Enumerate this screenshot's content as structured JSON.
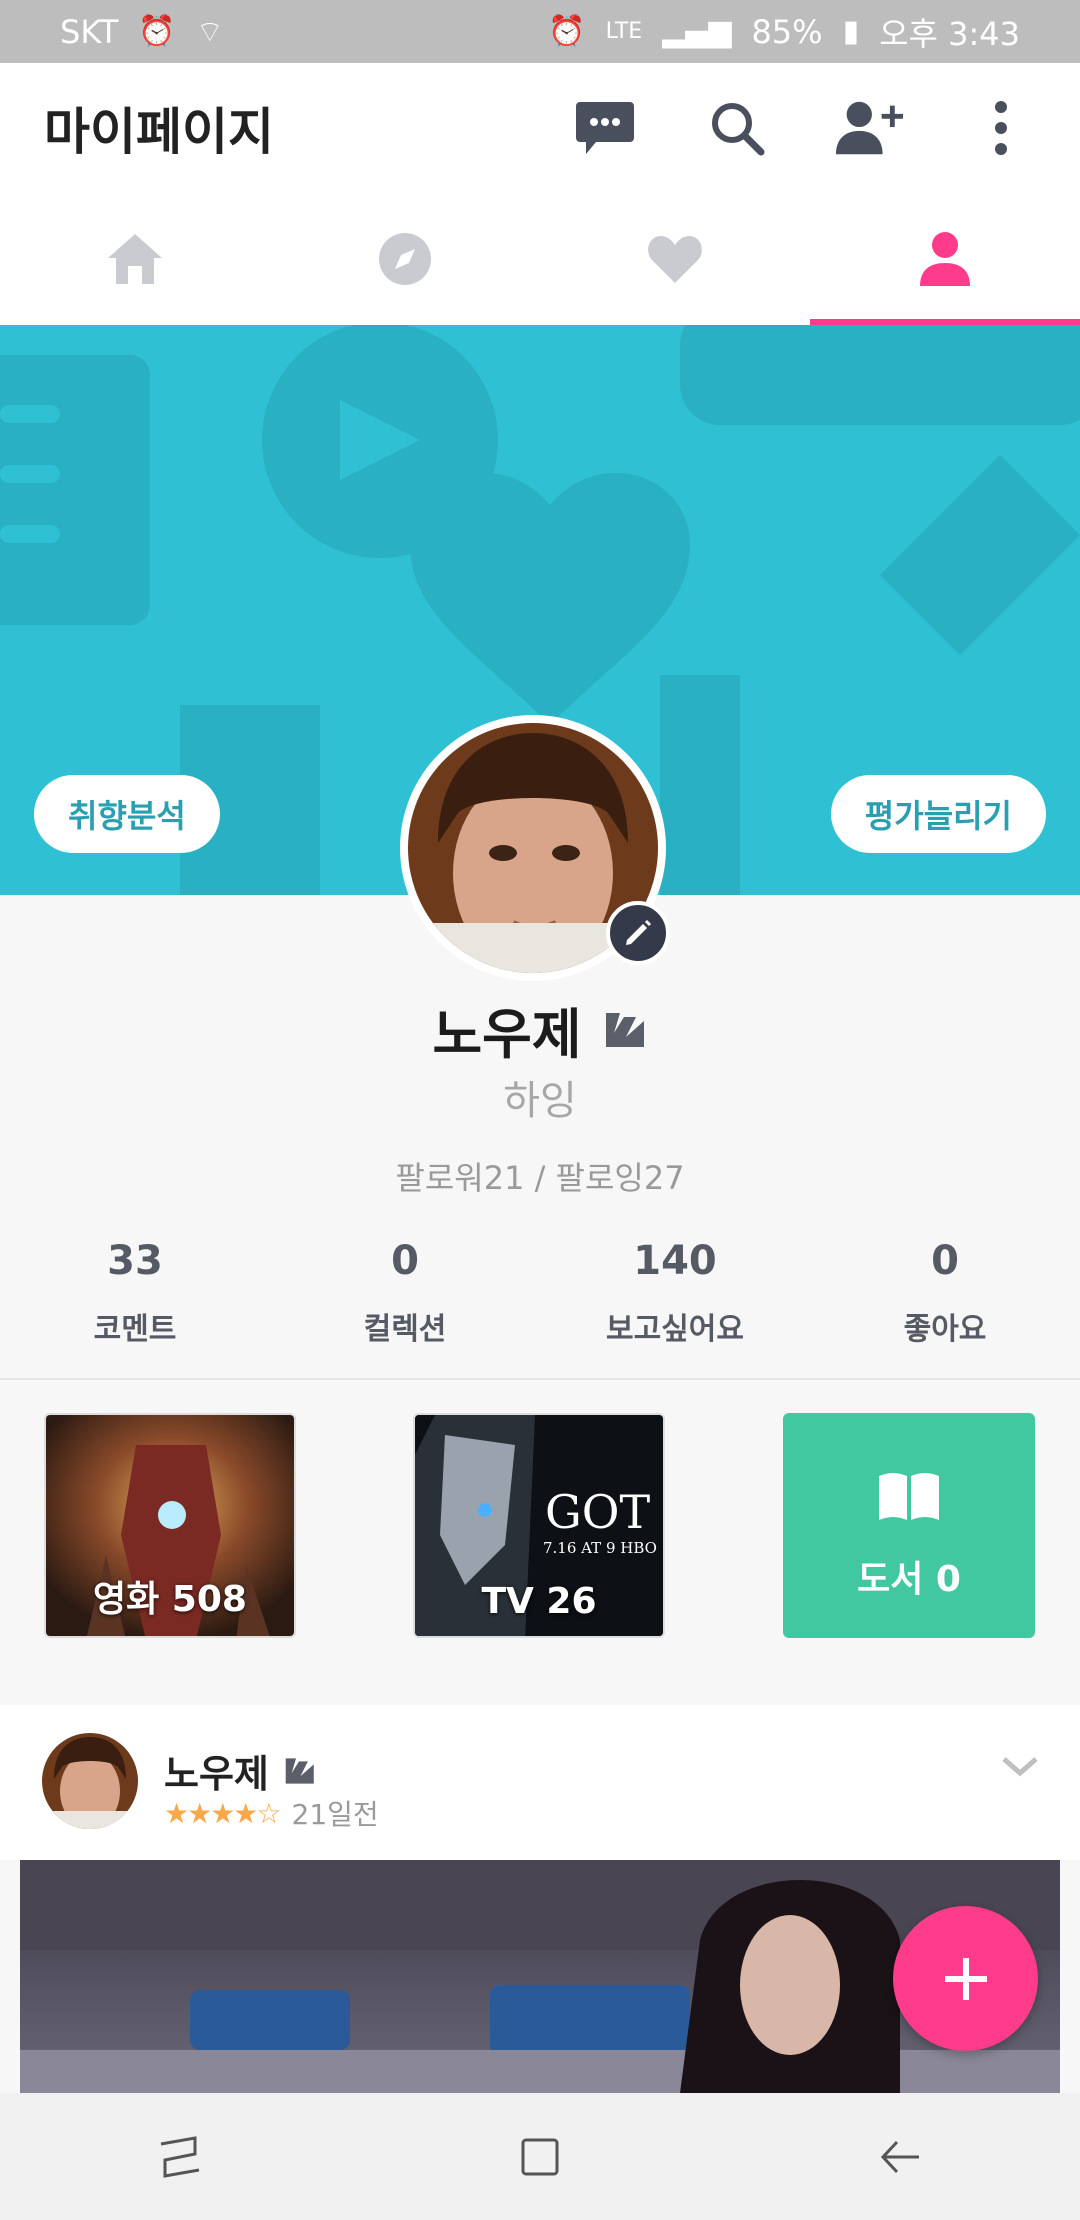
{
  "status_bar": {
    "carrier": "SKT",
    "network": "LTE",
    "battery": "85%",
    "time": "오후 3:43"
  },
  "app_bar": {
    "title": "마이페이지"
  },
  "tabs": [
    {
      "icon": "home-icon"
    },
    {
      "icon": "compass-icon"
    },
    {
      "icon": "heart-icon"
    },
    {
      "icon": "profile-icon",
      "active": true
    }
  ],
  "banner": {
    "left_button": "취향분석",
    "right_button": "평가늘리기"
  },
  "profile": {
    "name": "노우제",
    "status_message": "하잉",
    "follow_text": "팔로워21 / 팔로잉27"
  },
  "stats": [
    {
      "value": "33",
      "label": "코멘트"
    },
    {
      "value": "0",
      "label": "컬렉션"
    },
    {
      "value": "140",
      "label": "보고싶어요"
    },
    {
      "value": "0",
      "label": "좋아요"
    }
  ],
  "categories": [
    {
      "label": "영화 508"
    },
    {
      "label": "TV 26",
      "poster_text": "GOT",
      "poster_sub": "7.16 AT 9 HBO"
    },
    {
      "label": "도서 0"
    }
  ],
  "feed": {
    "name": "노우제",
    "rating": "★★★★☆",
    "time": "21일전"
  },
  "colors": {
    "accent": "#ff3c8c",
    "banner": "#2fc0d4",
    "books_card": "#41c8a1",
    "star": "#f7a84a"
  }
}
